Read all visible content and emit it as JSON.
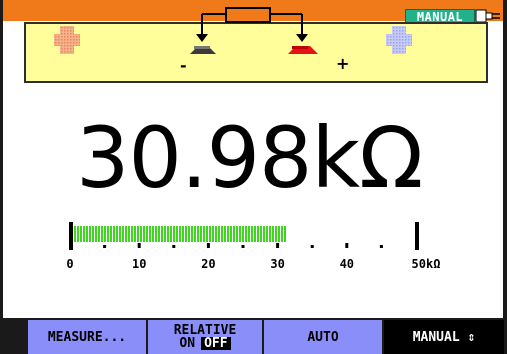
{
  "header": {
    "mode_badge": "MANUAL",
    "accent_color": "#f07a1a",
    "badge_color": "#22b28a",
    "icons": [
      "plug-icon"
    ]
  },
  "connection_panel": {
    "minus_sign": "-",
    "plus_sign": "+",
    "background_color": "#fffe9a",
    "icons": [
      "input-jack-left-icon",
      "resistor-icon",
      "probe-black-icon",
      "probe-red-icon",
      "input-jack-right-icon"
    ]
  },
  "reading": {
    "value": "30.98",
    "unit": "kΩ"
  },
  "bargraph": {
    "tick_labels": [
      "0",
      "10",
      "20",
      "30",
      "40",
      "50kΩ"
    ],
    "scale_max": 50,
    "fill_value": 30.98,
    "fill_color": "#3ed61e"
  },
  "softkeys": {
    "measure": "MEASURE...",
    "relative_title": "RELATIVE",
    "relative_on": "ON",
    "relative_off": "OFF",
    "auto": "AUTO",
    "manual": "MANUAL ⇕"
  }
}
